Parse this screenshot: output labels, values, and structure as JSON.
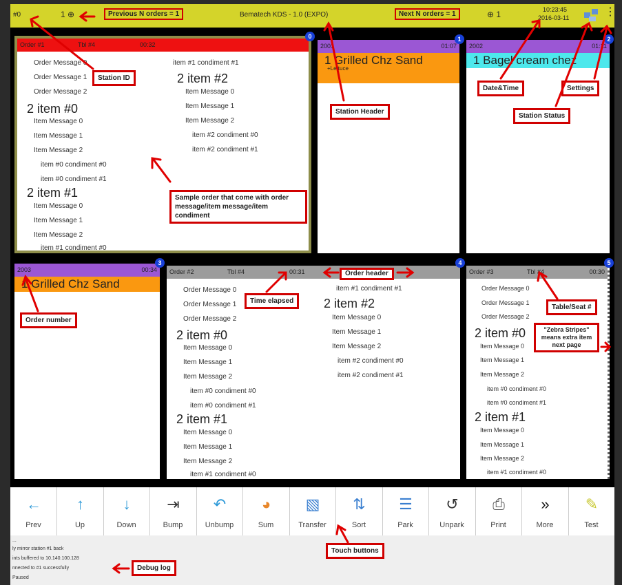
{
  "topbar": {
    "station_id": "#0",
    "prev_icon": "1 ⊕",
    "prev_label": "Previous N orders = 1",
    "title": "Bematech KDS - 1.0 (EXPO)",
    "next_label": "Next N orders = 1",
    "next_icon": "⊕ 1",
    "time": "10:23:45",
    "date": "2016-03-11"
  },
  "cells": {
    "c0": {
      "order": "Order #1",
      "table": "Tbl #4",
      "time": "00:32",
      "badge": "0",
      "left": [
        "Order Message 0",
        "Order Message 1",
        "Order Message 2"
      ],
      "item0": "2  item #0",
      "item0_lines": [
        "Item Message 0",
        "Item Message 1",
        "Item Message 2"
      ],
      "item0_cond": [
        "item #0 condiment #0",
        "item #0 condiment #1"
      ],
      "item1": "2  item #1",
      "item1_lines": [
        "Item Message 0",
        "Item Message 1",
        "Item Message 2"
      ],
      "item1_cond": [
        "item #1 condiment #0"
      ],
      "right_cond": "item #1 condiment #1",
      "item2": "2  item #2",
      "item2_lines": [
        "Item Message 0",
        "Item Message 1",
        "Item Message 2"
      ],
      "item2_cond": [
        "item #2 condiment #0",
        "item #2 condiment #1"
      ]
    },
    "c1": {
      "order": "2001",
      "time": "01:07",
      "badge": "1",
      "band": "1  Grilled Chz Sand",
      "sub": "+Lettuce"
    },
    "c2": {
      "order": "2002",
      "time": "01:11",
      "badge": "2",
      "band": "1  Bagel cream chez"
    },
    "c3": {
      "order": "2003",
      "time": "00:34",
      "badge": "3",
      "band": "1  Grilled Chz Sand"
    },
    "c4": {
      "order": "Order #2",
      "table": "Tbl #4",
      "time": "00:31",
      "badge": "4",
      "left": [
        "Order Message 0",
        "Order Message 1",
        "Order Message 2"
      ],
      "item0": "2  item #0",
      "item0_lines": [
        "Item Message 0",
        "Item Message 1",
        "Item Message 2"
      ],
      "item0_cond": [
        "item #0 condiment #0",
        "item #0 condiment #1"
      ],
      "item1": "2  item #1",
      "item1_lines": [
        "Item Message 0",
        "Item Message 1",
        "Item Message 2"
      ],
      "item1_cond": [
        "item #1 condiment #0"
      ],
      "right_cond": "item #1 condiment #1",
      "item2": "2  item #2",
      "item2_lines": [
        "Item Message 0",
        "Item Message 1",
        "Item Message 2"
      ],
      "item2_cond": [
        "item #2 condiment #0",
        "item #2 condiment #1"
      ]
    },
    "c5": {
      "order": "Order #3",
      "table": "Tbl #4",
      "time": "00:30",
      "badge": "5",
      "left": [
        "Order Message 0",
        "Order Message 1",
        "Order Message 2"
      ],
      "item0": "2  item #0",
      "item0_lines": [
        "Item Message 0",
        "Item Message 1",
        "Item Message 2"
      ],
      "item0_cond": [
        "item #0 condiment #0",
        "item #0 condiment #1"
      ],
      "item1": "2  item #1",
      "item1_lines": [
        "Item Message 0",
        "Item Message 1",
        "Item Message 2"
      ],
      "item1_cond": [
        "item #1 condiment #0"
      ]
    }
  },
  "toolbar": [
    {
      "label": "Prev",
      "icon": "arrow-left-icon",
      "glyph": "←",
      "color": "#2f9ad8"
    },
    {
      "label": "Up",
      "icon": "arrow-up-icon",
      "glyph": "↑",
      "color": "#2f9ad8"
    },
    {
      "label": "Down",
      "icon": "arrow-down-icon",
      "glyph": "↓",
      "color": "#2f9ad8"
    },
    {
      "label": "Bump",
      "icon": "bump-icon",
      "glyph": "⇥",
      "color": "#333"
    },
    {
      "label": "Unbump",
      "icon": "undo-icon",
      "glyph": "↶",
      "color": "#2f9ad8"
    },
    {
      "label": "Sum",
      "icon": "pie-chart-icon",
      "glyph": "◕",
      "color": "#e8872a"
    },
    {
      "label": "Transfer",
      "icon": "transfer-icon",
      "glyph": "▧",
      "color": "#3a7fd0"
    },
    {
      "label": "Sort",
      "icon": "sort-icon",
      "glyph": "⇅",
      "color": "#3a7fd0"
    },
    {
      "label": "Park",
      "icon": "park-icon",
      "glyph": "☰",
      "color": "#3a7fd0"
    },
    {
      "label": "Unpark",
      "icon": "unpark-icon",
      "glyph": "↺",
      "color": "#333"
    },
    {
      "label": "Print",
      "icon": "printer-icon",
      "glyph": "⎙",
      "color": "#555"
    },
    {
      "label": "More",
      "icon": "double-chevron-icon",
      "glyph": "»",
      "color": "#111"
    },
    {
      "label": "Test",
      "icon": "test-icon",
      "glyph": "✎",
      "color": "#c8c830"
    }
  ],
  "debug": [
    "...",
    "ly mirror station #1 back",
    "ints buffered to 10.140.100.128",
    "nnected to #1 successfully",
    "Paused"
  ],
  "annotations": {
    "station_id": "Station ID",
    "station_header": "Station Header",
    "datetime": "Date&Time",
    "settings": "Settings",
    "station_status": "Station Status",
    "sample": "Sample order that come with order message/item message/item condiment",
    "order_number": "Order number",
    "time_elapsed": "Time elapsed",
    "order_header": "Order header",
    "table_seat": "Table/Seat #",
    "zebra": "\"Zebra Stripes\" means extra item next page",
    "touch": "Touch buttons",
    "debug": "Debug log"
  }
}
